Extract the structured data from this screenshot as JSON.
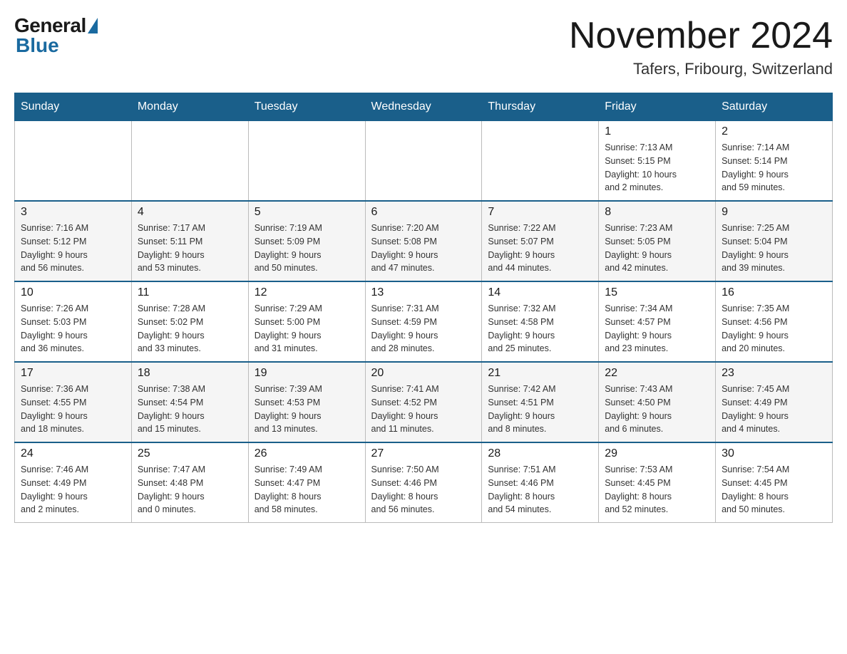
{
  "logo": {
    "general": "General",
    "blue": "Blue"
  },
  "title": {
    "month": "November 2024",
    "location": "Tafers, Fribourg, Switzerland"
  },
  "weekdays": [
    "Sunday",
    "Monday",
    "Tuesday",
    "Wednesday",
    "Thursday",
    "Friday",
    "Saturday"
  ],
  "weeks": [
    [
      {
        "day": "",
        "info": ""
      },
      {
        "day": "",
        "info": ""
      },
      {
        "day": "",
        "info": ""
      },
      {
        "day": "",
        "info": ""
      },
      {
        "day": "",
        "info": ""
      },
      {
        "day": "1",
        "info": "Sunrise: 7:13 AM\nSunset: 5:15 PM\nDaylight: 10 hours\nand 2 minutes."
      },
      {
        "day": "2",
        "info": "Sunrise: 7:14 AM\nSunset: 5:14 PM\nDaylight: 9 hours\nand 59 minutes."
      }
    ],
    [
      {
        "day": "3",
        "info": "Sunrise: 7:16 AM\nSunset: 5:12 PM\nDaylight: 9 hours\nand 56 minutes."
      },
      {
        "day": "4",
        "info": "Sunrise: 7:17 AM\nSunset: 5:11 PM\nDaylight: 9 hours\nand 53 minutes."
      },
      {
        "day": "5",
        "info": "Sunrise: 7:19 AM\nSunset: 5:09 PM\nDaylight: 9 hours\nand 50 minutes."
      },
      {
        "day": "6",
        "info": "Sunrise: 7:20 AM\nSunset: 5:08 PM\nDaylight: 9 hours\nand 47 minutes."
      },
      {
        "day": "7",
        "info": "Sunrise: 7:22 AM\nSunset: 5:07 PM\nDaylight: 9 hours\nand 44 minutes."
      },
      {
        "day": "8",
        "info": "Sunrise: 7:23 AM\nSunset: 5:05 PM\nDaylight: 9 hours\nand 42 minutes."
      },
      {
        "day": "9",
        "info": "Sunrise: 7:25 AM\nSunset: 5:04 PM\nDaylight: 9 hours\nand 39 minutes."
      }
    ],
    [
      {
        "day": "10",
        "info": "Sunrise: 7:26 AM\nSunset: 5:03 PM\nDaylight: 9 hours\nand 36 minutes."
      },
      {
        "day": "11",
        "info": "Sunrise: 7:28 AM\nSunset: 5:02 PM\nDaylight: 9 hours\nand 33 minutes."
      },
      {
        "day": "12",
        "info": "Sunrise: 7:29 AM\nSunset: 5:00 PM\nDaylight: 9 hours\nand 31 minutes."
      },
      {
        "day": "13",
        "info": "Sunrise: 7:31 AM\nSunset: 4:59 PM\nDaylight: 9 hours\nand 28 minutes."
      },
      {
        "day": "14",
        "info": "Sunrise: 7:32 AM\nSunset: 4:58 PM\nDaylight: 9 hours\nand 25 minutes."
      },
      {
        "day": "15",
        "info": "Sunrise: 7:34 AM\nSunset: 4:57 PM\nDaylight: 9 hours\nand 23 minutes."
      },
      {
        "day": "16",
        "info": "Sunrise: 7:35 AM\nSunset: 4:56 PM\nDaylight: 9 hours\nand 20 minutes."
      }
    ],
    [
      {
        "day": "17",
        "info": "Sunrise: 7:36 AM\nSunset: 4:55 PM\nDaylight: 9 hours\nand 18 minutes."
      },
      {
        "day": "18",
        "info": "Sunrise: 7:38 AM\nSunset: 4:54 PM\nDaylight: 9 hours\nand 15 minutes."
      },
      {
        "day": "19",
        "info": "Sunrise: 7:39 AM\nSunset: 4:53 PM\nDaylight: 9 hours\nand 13 minutes."
      },
      {
        "day": "20",
        "info": "Sunrise: 7:41 AM\nSunset: 4:52 PM\nDaylight: 9 hours\nand 11 minutes."
      },
      {
        "day": "21",
        "info": "Sunrise: 7:42 AM\nSunset: 4:51 PM\nDaylight: 9 hours\nand 8 minutes."
      },
      {
        "day": "22",
        "info": "Sunrise: 7:43 AM\nSunset: 4:50 PM\nDaylight: 9 hours\nand 6 minutes."
      },
      {
        "day": "23",
        "info": "Sunrise: 7:45 AM\nSunset: 4:49 PM\nDaylight: 9 hours\nand 4 minutes."
      }
    ],
    [
      {
        "day": "24",
        "info": "Sunrise: 7:46 AM\nSunset: 4:49 PM\nDaylight: 9 hours\nand 2 minutes."
      },
      {
        "day": "25",
        "info": "Sunrise: 7:47 AM\nSunset: 4:48 PM\nDaylight: 9 hours\nand 0 minutes."
      },
      {
        "day": "26",
        "info": "Sunrise: 7:49 AM\nSunset: 4:47 PM\nDaylight: 8 hours\nand 58 minutes."
      },
      {
        "day": "27",
        "info": "Sunrise: 7:50 AM\nSunset: 4:46 PM\nDaylight: 8 hours\nand 56 minutes."
      },
      {
        "day": "28",
        "info": "Sunrise: 7:51 AM\nSunset: 4:46 PM\nDaylight: 8 hours\nand 54 minutes."
      },
      {
        "day": "29",
        "info": "Sunrise: 7:53 AM\nSunset: 4:45 PM\nDaylight: 8 hours\nand 52 minutes."
      },
      {
        "day": "30",
        "info": "Sunrise: 7:54 AM\nSunset: 4:45 PM\nDaylight: 8 hours\nand 50 minutes."
      }
    ]
  ]
}
